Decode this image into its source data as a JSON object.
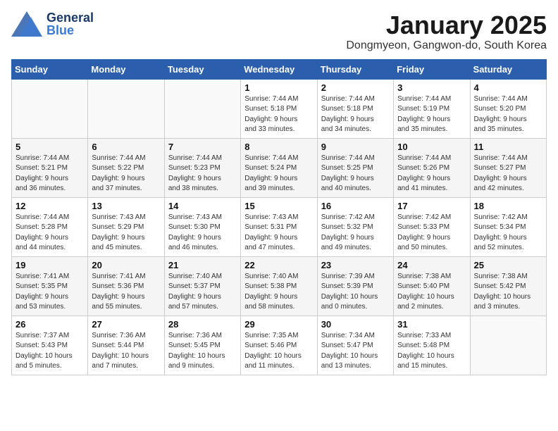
{
  "header": {
    "logo_general": "General",
    "logo_blue": "Blue",
    "month_title": "January 2025",
    "location": "Dongmyeon, Gangwon-do, South Korea"
  },
  "days_of_week": [
    "Sunday",
    "Monday",
    "Tuesday",
    "Wednesday",
    "Thursday",
    "Friday",
    "Saturday"
  ],
  "weeks": [
    [
      {
        "day": "",
        "info": ""
      },
      {
        "day": "",
        "info": ""
      },
      {
        "day": "",
        "info": ""
      },
      {
        "day": "1",
        "info": "Sunrise: 7:44 AM\nSunset: 5:18 PM\nDaylight: 9 hours\nand 33 minutes."
      },
      {
        "day": "2",
        "info": "Sunrise: 7:44 AM\nSunset: 5:18 PM\nDaylight: 9 hours\nand 34 minutes."
      },
      {
        "day": "3",
        "info": "Sunrise: 7:44 AM\nSunset: 5:19 PM\nDaylight: 9 hours\nand 35 minutes."
      },
      {
        "day": "4",
        "info": "Sunrise: 7:44 AM\nSunset: 5:20 PM\nDaylight: 9 hours\nand 35 minutes."
      }
    ],
    [
      {
        "day": "5",
        "info": "Sunrise: 7:44 AM\nSunset: 5:21 PM\nDaylight: 9 hours\nand 36 minutes."
      },
      {
        "day": "6",
        "info": "Sunrise: 7:44 AM\nSunset: 5:22 PM\nDaylight: 9 hours\nand 37 minutes."
      },
      {
        "day": "7",
        "info": "Sunrise: 7:44 AM\nSunset: 5:23 PM\nDaylight: 9 hours\nand 38 minutes."
      },
      {
        "day": "8",
        "info": "Sunrise: 7:44 AM\nSunset: 5:24 PM\nDaylight: 9 hours\nand 39 minutes."
      },
      {
        "day": "9",
        "info": "Sunrise: 7:44 AM\nSunset: 5:25 PM\nDaylight: 9 hours\nand 40 minutes."
      },
      {
        "day": "10",
        "info": "Sunrise: 7:44 AM\nSunset: 5:26 PM\nDaylight: 9 hours\nand 41 minutes."
      },
      {
        "day": "11",
        "info": "Sunrise: 7:44 AM\nSunset: 5:27 PM\nDaylight: 9 hours\nand 42 minutes."
      }
    ],
    [
      {
        "day": "12",
        "info": "Sunrise: 7:44 AM\nSunset: 5:28 PM\nDaylight: 9 hours\nand 44 minutes."
      },
      {
        "day": "13",
        "info": "Sunrise: 7:43 AM\nSunset: 5:29 PM\nDaylight: 9 hours\nand 45 minutes."
      },
      {
        "day": "14",
        "info": "Sunrise: 7:43 AM\nSunset: 5:30 PM\nDaylight: 9 hours\nand 46 minutes."
      },
      {
        "day": "15",
        "info": "Sunrise: 7:43 AM\nSunset: 5:31 PM\nDaylight: 9 hours\nand 47 minutes."
      },
      {
        "day": "16",
        "info": "Sunrise: 7:42 AM\nSunset: 5:32 PM\nDaylight: 9 hours\nand 49 minutes."
      },
      {
        "day": "17",
        "info": "Sunrise: 7:42 AM\nSunset: 5:33 PM\nDaylight: 9 hours\nand 50 minutes."
      },
      {
        "day": "18",
        "info": "Sunrise: 7:42 AM\nSunset: 5:34 PM\nDaylight: 9 hours\nand 52 minutes."
      }
    ],
    [
      {
        "day": "19",
        "info": "Sunrise: 7:41 AM\nSunset: 5:35 PM\nDaylight: 9 hours\nand 53 minutes."
      },
      {
        "day": "20",
        "info": "Sunrise: 7:41 AM\nSunset: 5:36 PM\nDaylight: 9 hours\nand 55 minutes."
      },
      {
        "day": "21",
        "info": "Sunrise: 7:40 AM\nSunset: 5:37 PM\nDaylight: 9 hours\nand 57 minutes."
      },
      {
        "day": "22",
        "info": "Sunrise: 7:40 AM\nSunset: 5:38 PM\nDaylight: 9 hours\nand 58 minutes."
      },
      {
        "day": "23",
        "info": "Sunrise: 7:39 AM\nSunset: 5:39 PM\nDaylight: 10 hours\nand 0 minutes."
      },
      {
        "day": "24",
        "info": "Sunrise: 7:38 AM\nSunset: 5:40 PM\nDaylight: 10 hours\nand 2 minutes."
      },
      {
        "day": "25",
        "info": "Sunrise: 7:38 AM\nSunset: 5:42 PM\nDaylight: 10 hours\nand 3 minutes."
      }
    ],
    [
      {
        "day": "26",
        "info": "Sunrise: 7:37 AM\nSunset: 5:43 PM\nDaylight: 10 hours\nand 5 minutes."
      },
      {
        "day": "27",
        "info": "Sunrise: 7:36 AM\nSunset: 5:44 PM\nDaylight: 10 hours\nand 7 minutes."
      },
      {
        "day": "28",
        "info": "Sunrise: 7:36 AM\nSunset: 5:45 PM\nDaylight: 10 hours\nand 9 minutes."
      },
      {
        "day": "29",
        "info": "Sunrise: 7:35 AM\nSunset: 5:46 PM\nDaylight: 10 hours\nand 11 minutes."
      },
      {
        "day": "30",
        "info": "Sunrise: 7:34 AM\nSunset: 5:47 PM\nDaylight: 10 hours\nand 13 minutes."
      },
      {
        "day": "31",
        "info": "Sunrise: 7:33 AM\nSunset: 5:48 PM\nDaylight: 10 hours\nand 15 minutes."
      },
      {
        "day": "",
        "info": ""
      }
    ]
  ]
}
